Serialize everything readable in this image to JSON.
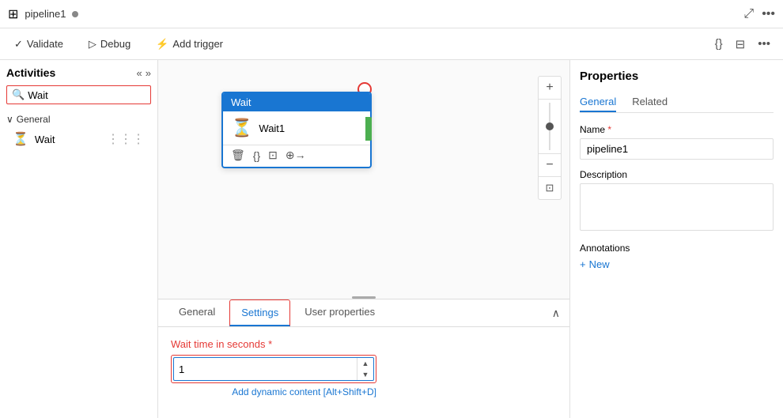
{
  "topbar": {
    "title": "pipeline1",
    "dot": "●"
  },
  "toolbar": {
    "validate_label": "Validate",
    "debug_label": "Debug",
    "add_trigger_label": "Add trigger"
  },
  "sidebar": {
    "title": "Activities",
    "search_placeholder": "Wait",
    "search_value": "Wait",
    "category": "General",
    "activity_label": "Wait",
    "collapse_icon": "«",
    "expand_icon": "»"
  },
  "canvas": {
    "wait_node": {
      "header": "Wait",
      "label": "Wait1",
      "icon": "⏳"
    },
    "zoom": {
      "plus": "+",
      "minus": "−"
    }
  },
  "bottom_panel": {
    "tabs": [
      {
        "label": "General",
        "active": false
      },
      {
        "label": "Settings",
        "active": true
      },
      {
        "label": "User properties",
        "active": false
      }
    ],
    "wait_time_label": "Wait time in seconds",
    "required_marker": " *",
    "wait_time_value": "1",
    "dynamic_content_link": "Add dynamic content [Alt+Shift+D]"
  },
  "properties": {
    "title": "Properties",
    "tabs": [
      {
        "label": "General",
        "active": true
      },
      {
        "label": "Related",
        "active": false
      }
    ],
    "name_label": "Name",
    "name_required": "*",
    "name_value": "pipeline1",
    "description_label": "Description",
    "description_value": "",
    "annotations_label": "Annotations",
    "add_new_label": "New",
    "add_icon": "+"
  }
}
